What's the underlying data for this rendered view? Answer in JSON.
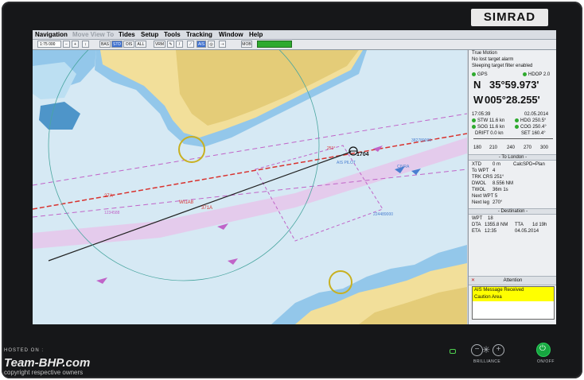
{
  "brand": "SIMRAD",
  "menu": [
    "Navigation",
    "Move View To",
    "Tides",
    "Setup",
    "Tools",
    "Tracking",
    "Window",
    "Help"
  ],
  "toolbar": {
    "scale": "1:75 000",
    "buttons": [
      "BAS",
      "STD",
      "OIS",
      "ALL",
      "VRM",
      "AIS",
      "MOB"
    ]
  },
  "chart": {
    "labels": {
      "b1704": "1704",
      "pilot": "AIS PILOT",
      "w1": "WI1A8",
      "w2": "371A",
      "v1": "27A",
      "n1": "1234588",
      "n2": "382789000",
      "n3": "224489000",
      "n4": "CIVRA",
      "c1": "251°"
    }
  },
  "panel": {
    "mode": "True Motion",
    "alarm1": "No lost target alarm",
    "alarm2": "Sleeping target filter enabled",
    "gps": "GPS",
    "hdop": "HDOP 2.0",
    "lat_h": "N",
    "lat": "35°59.973'",
    "lon_h": "W",
    "lon": "005°28.255'",
    "time": "17:05:39",
    "date": "02.05.2014",
    "stw": "STW",
    "stw_v": "11.6 kn",
    "hdg": "HDG",
    "hdg_v": "250.5°",
    "sog": "SOG",
    "sog_v": "11.6 kn",
    "cog": "COG",
    "cog_v": "250.4°",
    "drift": "DRIFT 0.0 kn",
    "set": "SET",
    "set_v": "160.4°",
    "compass": [
      "180",
      "210",
      "240",
      "270",
      "300"
    ],
    "route_hdr": "- To London -",
    "xtd": "XTD",
    "xtd_v": "0 m",
    "xtd_n": "CalcSPD=Plan",
    "towpt": "To WPT",
    "towpt_v": "4",
    "trk": "TRK CRS 251°",
    "dwol": "DWOL",
    "dwol_v": "8.556 NM",
    "twol": "TWOL",
    "twol_v": "36m 1s",
    "next": "Next WPT 5",
    "nextleg": "Next leg",
    "nextleg_v": "270°",
    "dest_hdr": "- Destination -",
    "wpt": "WPT",
    "wpt_v": "18",
    "dta": "DTA",
    "dta_v": "1355.8 NM",
    "tta": "TTA",
    "tta_v": "1d 19h",
    "eta": "ETA",
    "eta_v": "12:35",
    "eta_d": "04.05.2014",
    "att": "Attention",
    "alerts": [
      "AIS Message Received",
      "Caution Area"
    ]
  },
  "hw": {
    "brilliance": "BRILLIANCE",
    "onoff": "ON/OFF"
  },
  "watermark": {
    "l1": "HOSTED ON :",
    "l2": "Team-BHP.com",
    "l3": "copyright respective owners"
  }
}
